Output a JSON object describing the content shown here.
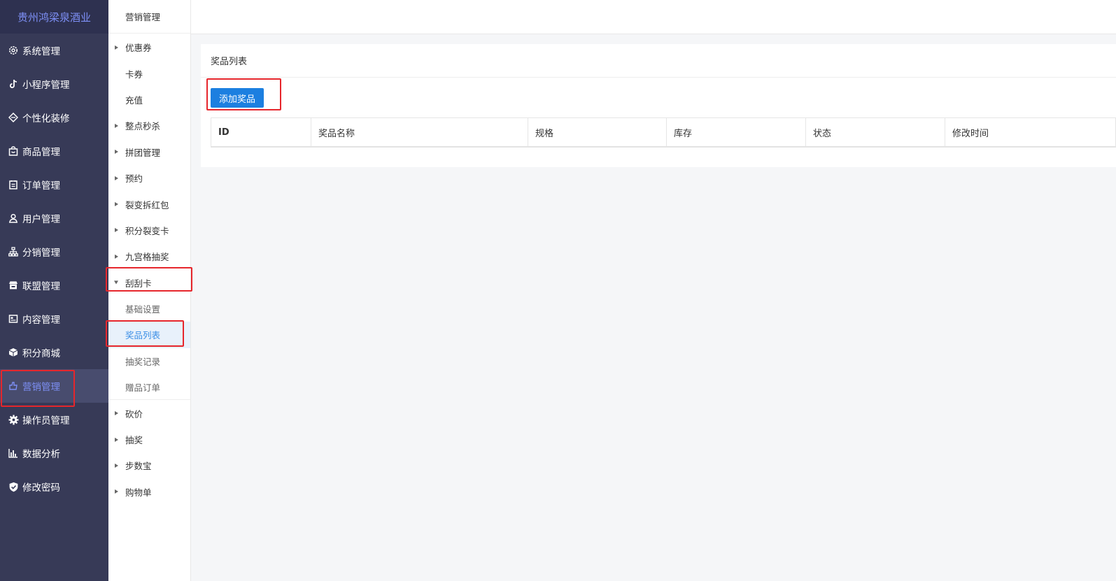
{
  "sidebar": {
    "brand": "贵州鸿梁泉酒业",
    "items": [
      {
        "label": "系统管理",
        "icon": "gear-outline-icon"
      },
      {
        "label": "小程序管理",
        "icon": "tiktok-icon"
      },
      {
        "label": "个性化装修",
        "icon": "diamond-icon"
      },
      {
        "label": "商品管理",
        "icon": "shopping-bag-icon"
      },
      {
        "label": "订单管理",
        "icon": "clipboard-icon"
      },
      {
        "label": "用户管理",
        "icon": "user-icon"
      },
      {
        "label": "分销管理",
        "icon": "hierarchy-icon"
      },
      {
        "label": "联盟管理",
        "icon": "store-icon"
      },
      {
        "label": "内容管理",
        "icon": "content-icon"
      },
      {
        "label": "积分商城",
        "icon": "cube-icon"
      },
      {
        "label": "营销管理",
        "icon": "marketing-icon",
        "active": true
      },
      {
        "label": "操作员管理",
        "icon": "gear-solid-icon"
      },
      {
        "label": "数据分析",
        "icon": "bar-chart-icon"
      },
      {
        "label": "修改密码",
        "icon": "shield-check-icon"
      }
    ]
  },
  "submenu": {
    "title": "营销管理",
    "items": [
      {
        "label": "优惠券",
        "arrow": true
      },
      {
        "label": "卡券"
      },
      {
        "label": "充值"
      },
      {
        "label": "整点秒杀",
        "arrow": true
      },
      {
        "label": "拼团管理",
        "arrow": true
      },
      {
        "label": "预约",
        "arrow": true
      },
      {
        "label": "裂变拆红包",
        "arrow": true
      },
      {
        "label": "积分裂变卡",
        "arrow": true
      },
      {
        "label": "九宫格抽奖",
        "arrow": true
      },
      {
        "label": "刮刮卡",
        "arrow": true,
        "expanded": true
      },
      {
        "label": "基础设置",
        "child": true
      },
      {
        "label": "奖品列表",
        "child": true,
        "selected": true
      },
      {
        "label": "抽奖记录",
        "child": true
      },
      {
        "label": "赠品订单",
        "child": true
      },
      {
        "label": "砍价",
        "arrow": true
      },
      {
        "label": "抽奖",
        "arrow": true
      },
      {
        "label": "步数宝",
        "arrow": true
      },
      {
        "label": "购物单",
        "arrow": true
      }
    ]
  },
  "main": {
    "card_title": "奖品列表",
    "add_button": "添加奖品",
    "columns": [
      "ID",
      "奖品名称",
      "规格",
      "库存",
      "状态",
      "修改时间"
    ]
  },
  "colors": {
    "sidebar_bg": "#373a57",
    "brand_text": "#7d8ff5",
    "primary_button": "#1c7fe0",
    "highlight": "#e6262c"
  }
}
